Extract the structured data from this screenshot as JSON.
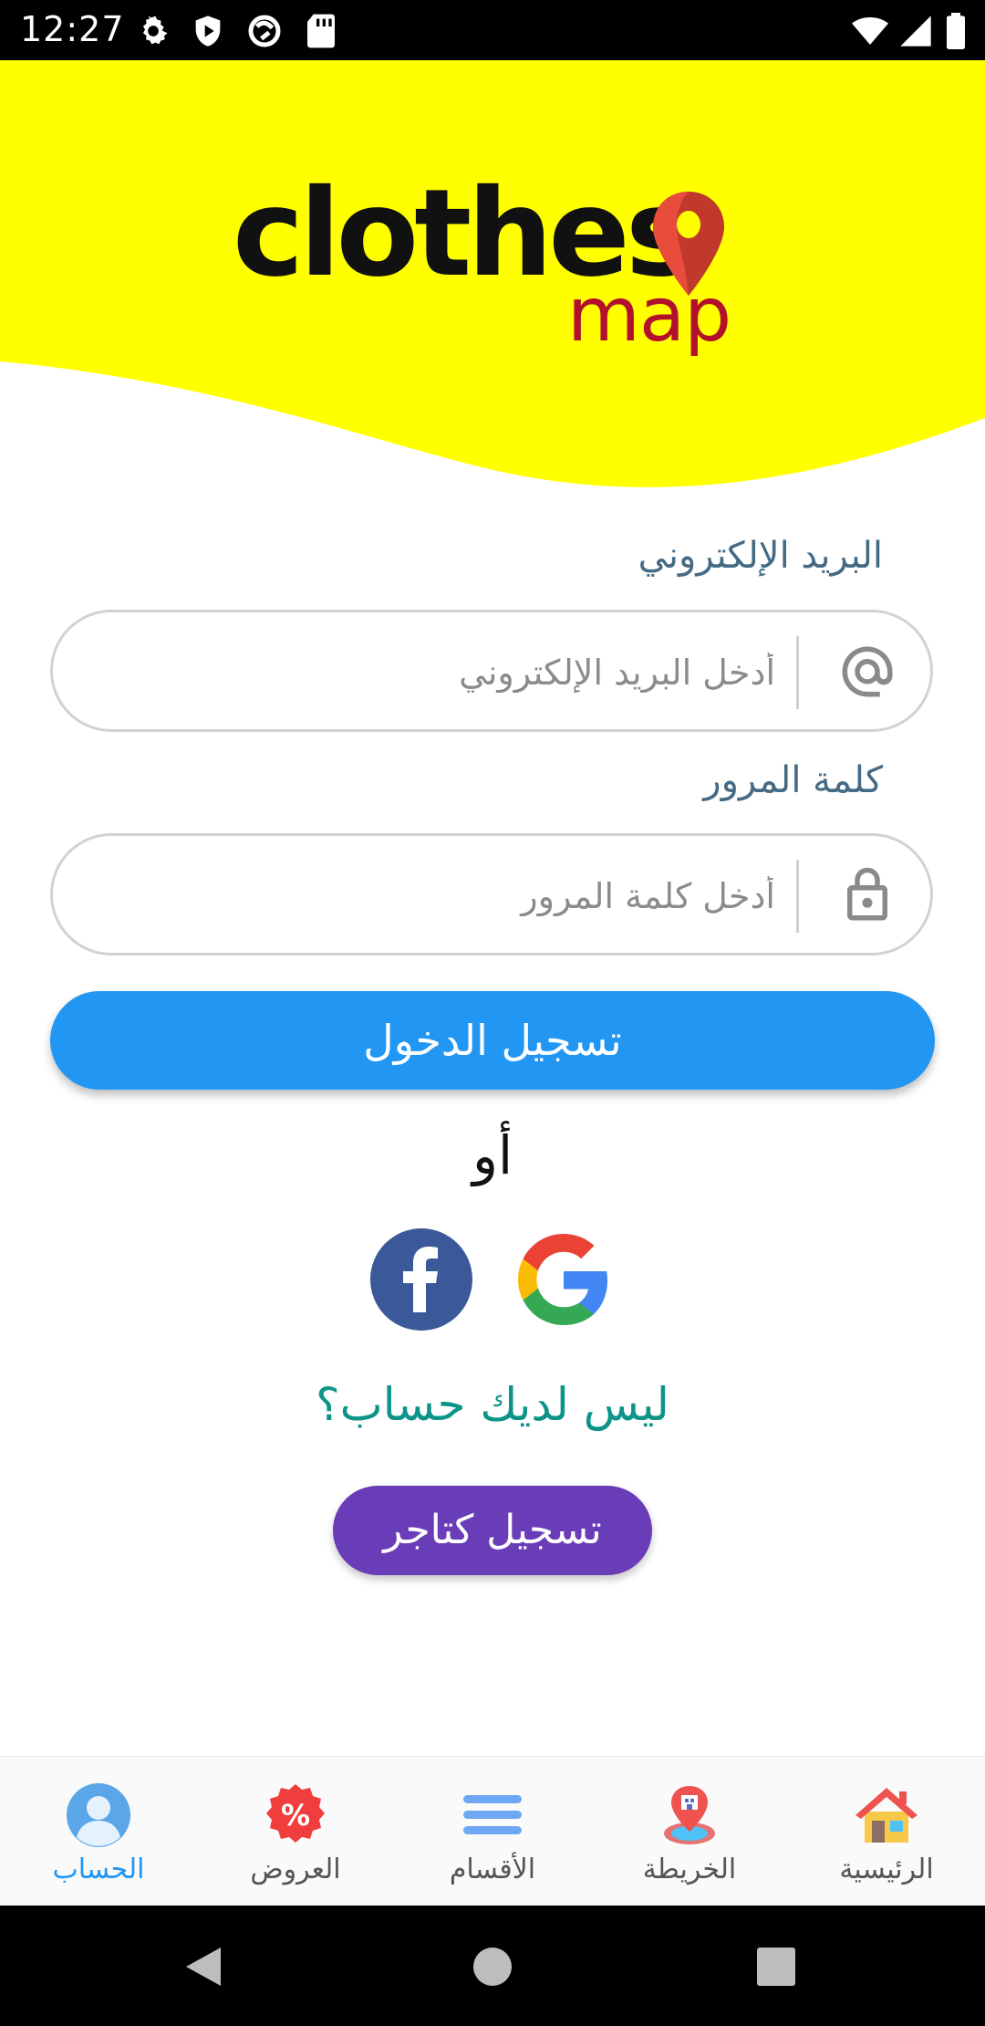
{
  "status_bar": {
    "time": "12:27",
    "icons": [
      "gear-icon",
      "shield-icon",
      "sync-icon",
      "sd-card-icon",
      "wifi-icon",
      "signal-icon",
      "battery-icon"
    ]
  },
  "header": {
    "logo_word": "clothes",
    "logo_sub": "map",
    "colors": {
      "background": "#ffff00",
      "word": "#111111",
      "sub": "#b3112b",
      "pin": "#c0392b"
    }
  },
  "form": {
    "email": {
      "label": "البريد الإلكتروني",
      "placeholder": "أدخل البريد الإلكتروني",
      "value": "",
      "icon": "at-icon"
    },
    "password": {
      "label": "كلمة المرور",
      "placeholder": "أدخل كلمة المرور",
      "value": "",
      "icon": "lock-icon"
    },
    "login_button": "تسجيل الدخول",
    "or_text": "أو",
    "social": [
      "facebook-icon",
      "google-icon"
    ],
    "no_account": "ليس لديك حساب؟",
    "merchant_button": "تسجيل كتاجر",
    "colors": {
      "primary": "#2196f3",
      "merchant": "#6a3db8",
      "link": "#0d9488",
      "label": "#456a85"
    }
  },
  "bottom_nav": {
    "items": [
      {
        "label": "الحساب",
        "icon": "account-icon",
        "active": true
      },
      {
        "label": "العروض",
        "icon": "offers-icon",
        "active": false
      },
      {
        "label": "الأقسام",
        "icon": "menu-icon",
        "active": false
      },
      {
        "label": "الخريطة",
        "icon": "map-icon",
        "active": false
      },
      {
        "label": "الرئيسية",
        "icon": "home-icon",
        "active": false
      }
    ]
  },
  "system_nav": {
    "buttons": [
      "back-icon",
      "home-circle-icon",
      "recents-icon"
    ]
  }
}
